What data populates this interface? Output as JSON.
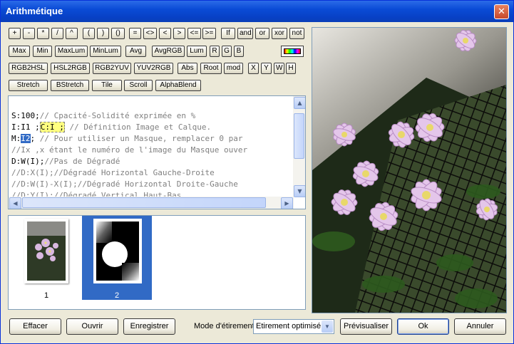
{
  "window": {
    "title": "Arithmétique",
    "close": "✕"
  },
  "operators_row1": [
    "+",
    "-",
    "*",
    "/",
    "^",
    "(",
    ")",
    "()",
    "=",
    "<>",
    "<",
    ">",
    "<=",
    ">=",
    "If",
    "and",
    "or",
    "xor",
    "not"
  ],
  "functions_row2": [
    "Max",
    "Min",
    "MaxLum",
    "MinLum",
    "Avg",
    "AvgRGB",
    "Lum",
    "R",
    "G",
    "B"
  ],
  "functions_row3": [
    "RGB2HSL",
    "HSL2RGB",
    "RGB2YUV",
    "YUV2RGB",
    "Abs",
    "Root",
    "mod",
    "X",
    "Y",
    "W",
    "H"
  ],
  "modes_row4": [
    "Stretch",
    "BStretch",
    "Tile",
    "Scroll",
    "AlphaBlend"
  ],
  "editor": {
    "line1_code": "S:100;",
    "line1_comment": "// Cpacité-Solidité exprimée en %",
    "line2_code_a": "I:I1 ;",
    "line2_hl": "C:I ;",
    "line2_comment": "// Définition Image et Calque.",
    "line3_code_a": "M:",
    "line3_sel": "I2",
    "line3_code_b": ";",
    "line3_comment": "// Pour utiliser un Masque, remplacer 0 par",
    "line4_comment": "//Ix ,x étant le numéro de l'image du Masque ouver",
    "line5_code": "D:W(I);",
    "line5_comment": "//Pas de Dégradé",
    "line6_comment": "//D:X(I);//Dégradé Horizontal Gauche-Droite",
    "line7_comment": "//D:W(I)-X(I);//Dégradé Horizontal Droite-Gauche",
    "line8_comment": "//D:Y(I);//Dégradé Vertical Haut-Bas"
  },
  "thumbnails": [
    {
      "label": "1"
    },
    {
      "label": "2"
    }
  ],
  "footer": {
    "effacer": "Effacer",
    "ouvrir": "Ouvrir",
    "enregistrer": "Enregistrer",
    "mode_label": "Mode d'étirement",
    "mode_value": "Etirement optimisé",
    "previsualiser": "Prévisualiser",
    "ok": "Ok",
    "annuler": "Annuler"
  }
}
